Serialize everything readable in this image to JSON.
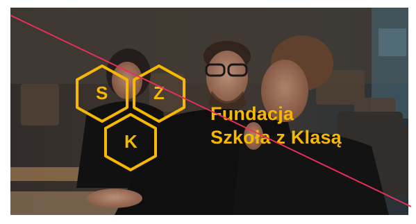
{
  "brand": {
    "name_line1": "Fundacja",
    "name_line2": "Szkoła z Klasą",
    "color": "#f6b800"
  },
  "logo": {
    "letters": [
      "S",
      "Z",
      "K"
    ],
    "icon": "hexagon-honeycomb-icon"
  },
  "photo": {
    "icon": "people-photo"
  },
  "overlay": {
    "strike_color": "#e8305a",
    "icon": "diagonal-strike-line"
  }
}
